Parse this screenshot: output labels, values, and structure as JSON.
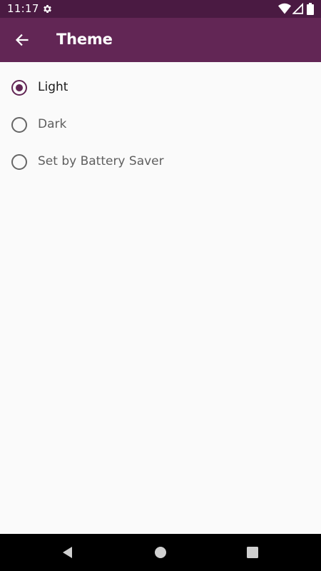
{
  "status_bar": {
    "time": "11:17"
  },
  "app_bar": {
    "title": "Theme"
  },
  "theme_options": [
    {
      "label": "Light",
      "selected": true
    },
    {
      "label": "Dark",
      "selected": false
    },
    {
      "label": "Set by Battery Saver",
      "selected": false
    }
  ],
  "colors": {
    "status_bar": "#4a1a42",
    "app_bar": "#622655",
    "accent": "#622655",
    "background": "#fafafa"
  },
  "icons": {
    "status_settings": "gear-icon",
    "status_wifi": "wifi-icon",
    "status_signal": "signal-icon",
    "status_battery": "battery-icon",
    "back": "arrow-back-icon",
    "nav_back": "triangle-back-icon",
    "nav_home": "circle-home-icon",
    "nav_recents": "square-recents-icon"
  }
}
